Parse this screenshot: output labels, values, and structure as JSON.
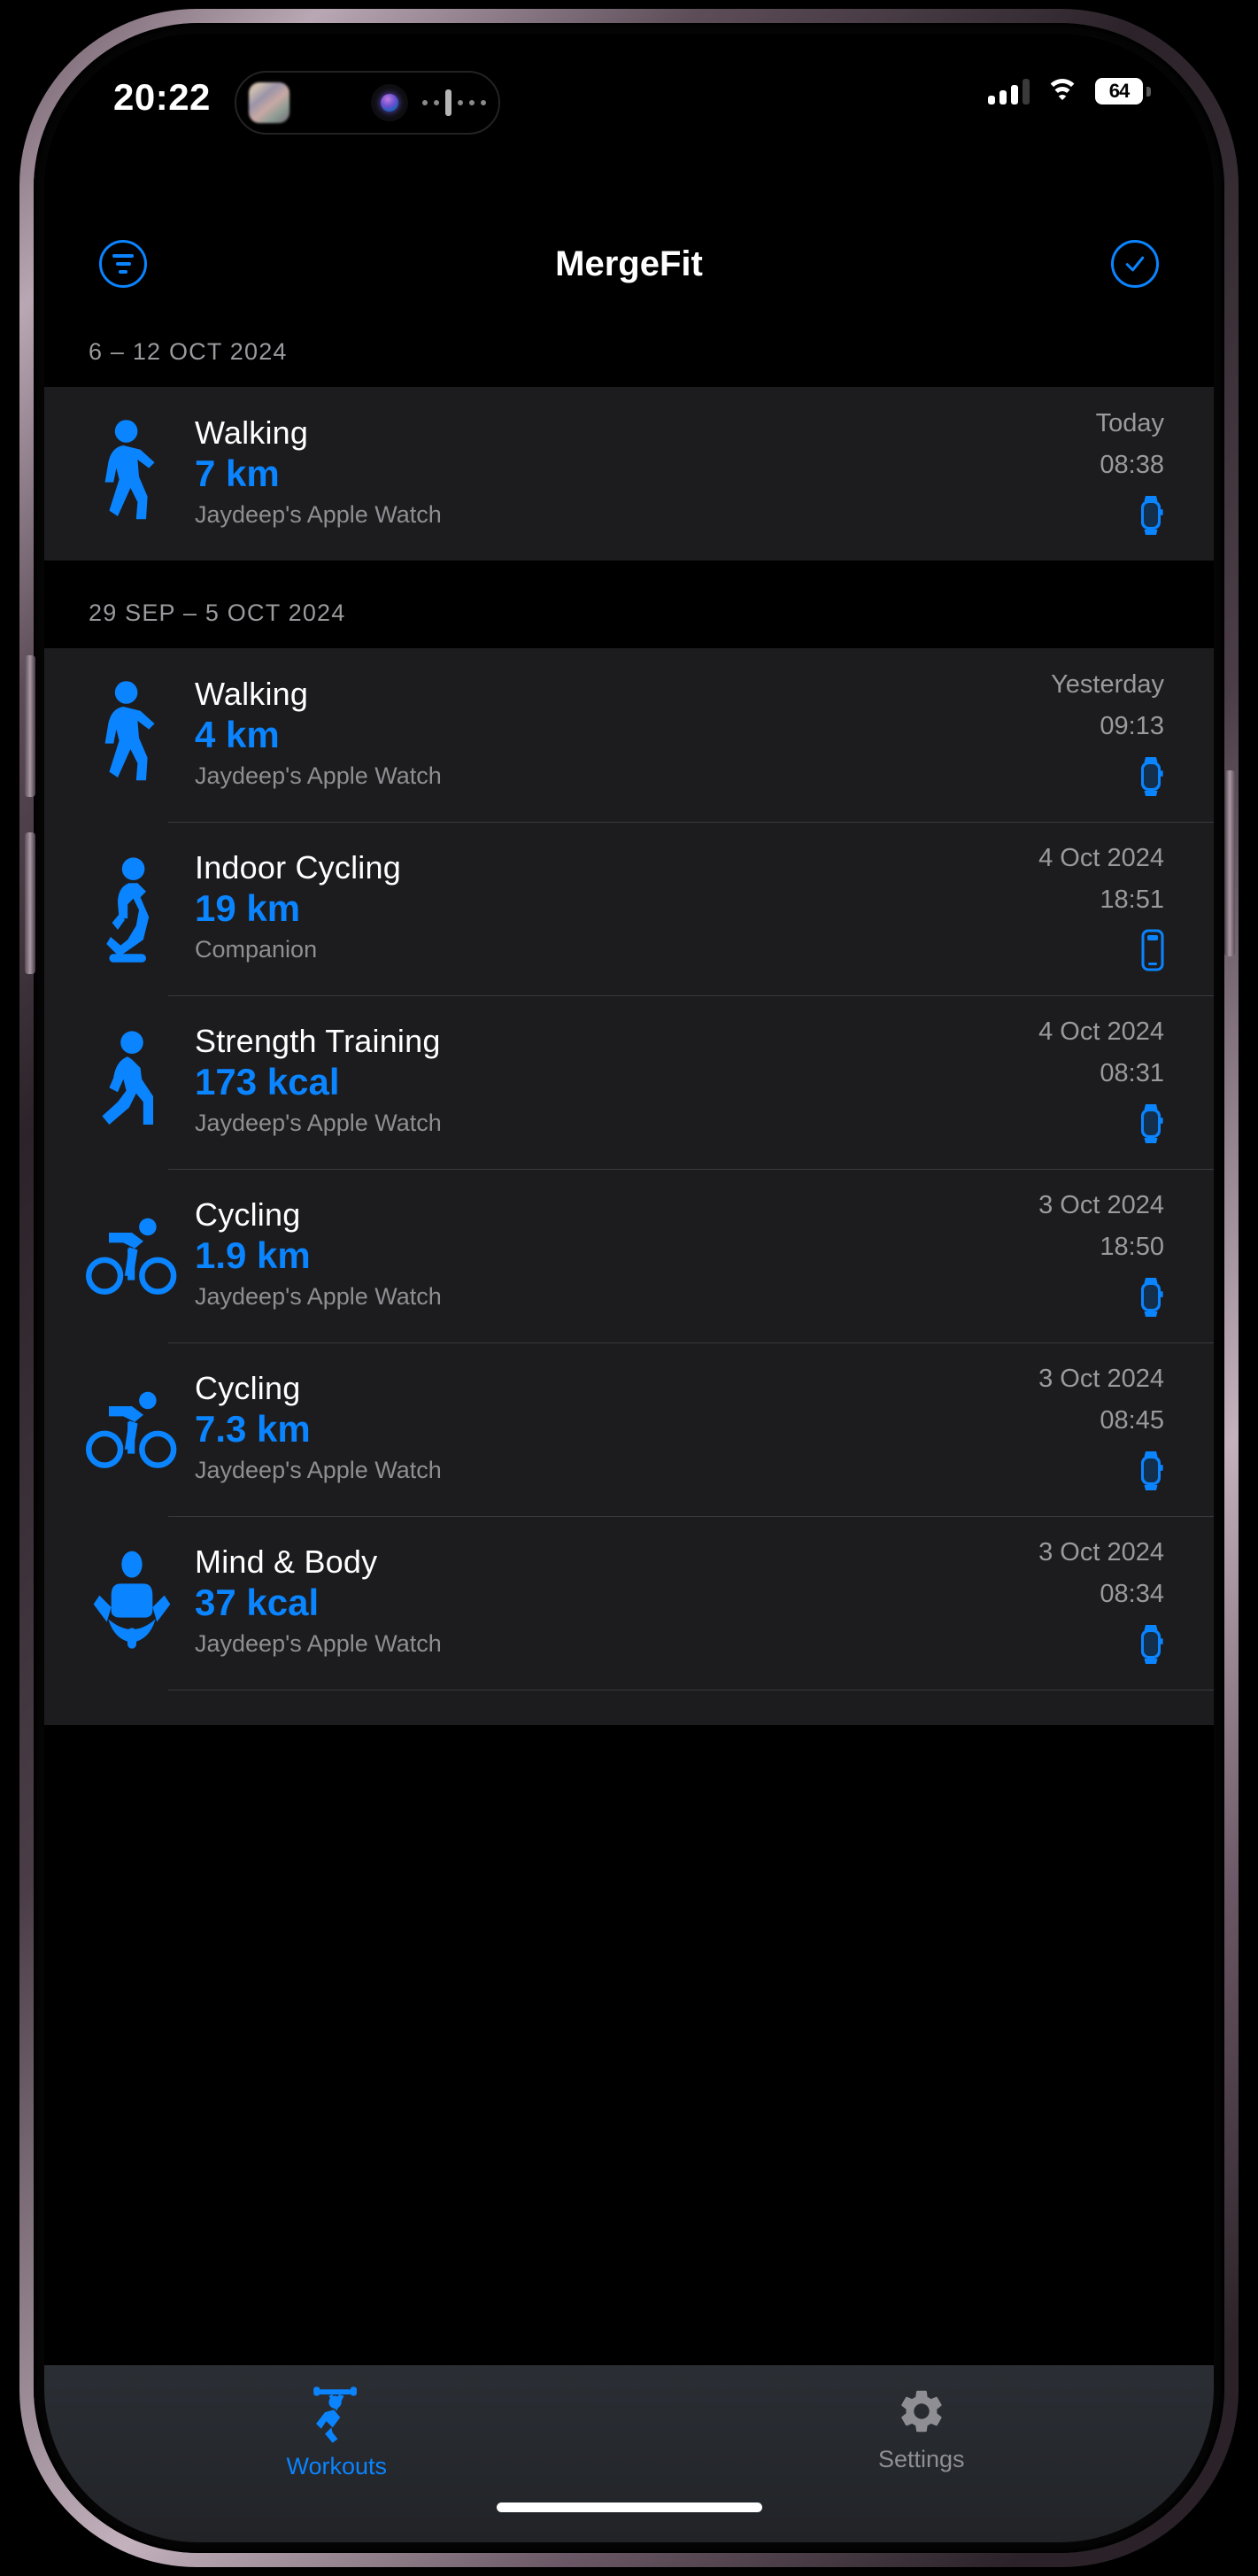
{
  "status_bar": {
    "time": "20:22",
    "battery_percent": "64",
    "signal_icon": "cellular-signal-icon",
    "wifi_icon": "wifi-icon",
    "battery_icon": "battery-icon",
    "island_siri_icon": "siri-orb-icon",
    "island_audio_icon": "audio-waveform-icon",
    "island_thumb_icon": "app-thumbnail-icon"
  },
  "nav": {
    "title": "MergeFit",
    "filter_icon": "filter-icon",
    "done_icon": "checkmark-circle-icon"
  },
  "sections": [
    {
      "header": "6 – 12 OCT 2024",
      "rows": [
        {
          "activity": "Walking",
          "metric": "7 km",
          "source": "Jaydeep's Apple Watch",
          "date": "Today",
          "time": "08:38",
          "activity_icon": "walking-figure-icon",
          "device_icon": "apple-watch-icon"
        }
      ]
    },
    {
      "header": "29 SEP – 5 OCT 2024",
      "rows": [
        {
          "activity": "Walking",
          "metric": "4 km",
          "source": "Jaydeep's Apple Watch",
          "date": "Yesterday",
          "time": "09:13",
          "activity_icon": "walking-figure-icon",
          "device_icon": "apple-watch-icon"
        },
        {
          "activity": "Indoor Cycling",
          "metric": "19 km",
          "source": "Companion",
          "date": "4 Oct 2024",
          "time": "18:51",
          "activity_icon": "indoor-cycling-figure-icon",
          "device_icon": "iphone-icon"
        },
        {
          "activity": "Strength Training",
          "metric": "173 kcal",
          "source": "Jaydeep's Apple Watch",
          "date": "4 Oct 2024",
          "time": "08:31",
          "activity_icon": "strength-training-figure-icon",
          "device_icon": "apple-watch-icon"
        },
        {
          "activity": "Cycling",
          "metric": "1.9 km",
          "source": "Jaydeep's Apple Watch",
          "date": "3 Oct 2024",
          "time": "18:50",
          "activity_icon": "cycling-bicycle-icon",
          "device_icon": "apple-watch-icon"
        },
        {
          "activity": "Cycling",
          "metric": "7.3 km",
          "source": "Jaydeep's Apple Watch",
          "date": "3 Oct 2024",
          "time": "08:45",
          "activity_icon": "cycling-bicycle-icon",
          "device_icon": "apple-watch-icon"
        },
        {
          "activity": "Mind & Body",
          "metric": "37 kcal",
          "source": "Jaydeep's Apple Watch",
          "date": "3 Oct 2024",
          "time": "08:34",
          "activity_icon": "meditation-figure-icon",
          "device_icon": "apple-watch-icon"
        }
      ]
    }
  ],
  "tab_bar": {
    "tabs": [
      {
        "label": "Workouts",
        "icon": "workouts-barbell-figure-icon",
        "active": true
      },
      {
        "label": "Settings",
        "icon": "gear-icon",
        "active": false
      }
    ]
  },
  "colors": {
    "accent": "#0a84ff",
    "card": "#1c1c1e",
    "background": "#000000",
    "secondary_text": "#8e8e93"
  }
}
